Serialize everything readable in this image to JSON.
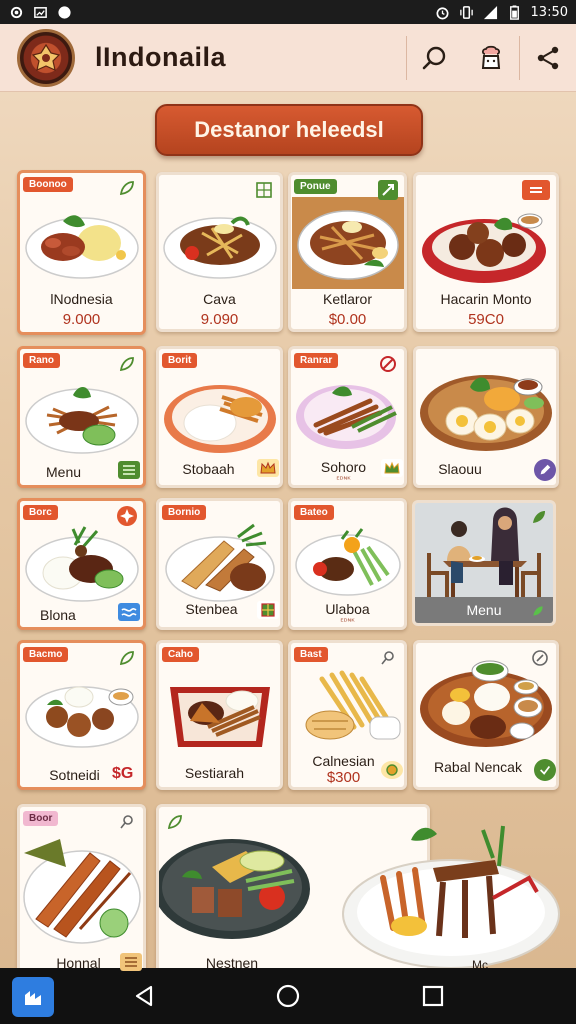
{
  "status_bar": {
    "time": "13:50",
    "left_icons": [
      "settings-icon",
      "cast-icon",
      "compass-icon"
    ],
    "right_icons": [
      "alarm-icon",
      "vibrate-icon",
      "signal-icon",
      "battery-icon"
    ]
  },
  "app_bar": {
    "title": "lIndonaila",
    "actions": [
      "search-icon",
      "chef-icon",
      "share-icon"
    ]
  },
  "banner": {
    "label": "Destanor heleedsl"
  },
  "colors": {
    "accent": "#e2572e",
    "card_border": "#e58e5c",
    "price": "#b0331e",
    "green": "#4f8d2f",
    "appbar": "#f7e2d6"
  },
  "cards": [
    {
      "tag": "Boonoo",
      "name": "lNodnesia",
      "price": "9.000"
    },
    {
      "name": "Cava",
      "price": "9.090"
    },
    {
      "tag": "Ponue",
      "name": "Ketlaror",
      "price": "$0.00"
    },
    {
      "name": "Hacarin Monto",
      "price": "59C0"
    },
    {
      "tag": "Rano",
      "name": "Menu"
    },
    {
      "tag": "Borit",
      "name": "Stobaah"
    },
    {
      "tag": "Ranrar",
      "name": "Sohoro",
      "sub": "ᴱᴰᴺᴷ"
    },
    {
      "name": "Slaouu"
    },
    {
      "tag": "Borc",
      "name": "Blona"
    },
    {
      "tag": "Bornio",
      "name": "Stenbea"
    },
    {
      "tag": "Bateo",
      "name": "Ulaboa",
      "sub": "ᴱᴰᴺᴷ"
    },
    {
      "tag": "Bacmo",
      "name": "Sotneidi",
      "price": "$G"
    },
    {
      "tag": "Caho",
      "name": "Sestiarah"
    },
    {
      "tag": "Bast",
      "name": "Calnesian",
      "price": "$300"
    },
    {
      "name": "Rabal Nencak"
    },
    {
      "tag": "Boor",
      "name": "Honnal"
    },
    {
      "name": "Nestnen"
    },
    {
      "name": "Mc"
    }
  ],
  "scene": {
    "label": "Menu"
  },
  "nav": {
    "items": [
      "app-icon",
      "back-icon",
      "home-icon",
      "recents-icon"
    ]
  }
}
